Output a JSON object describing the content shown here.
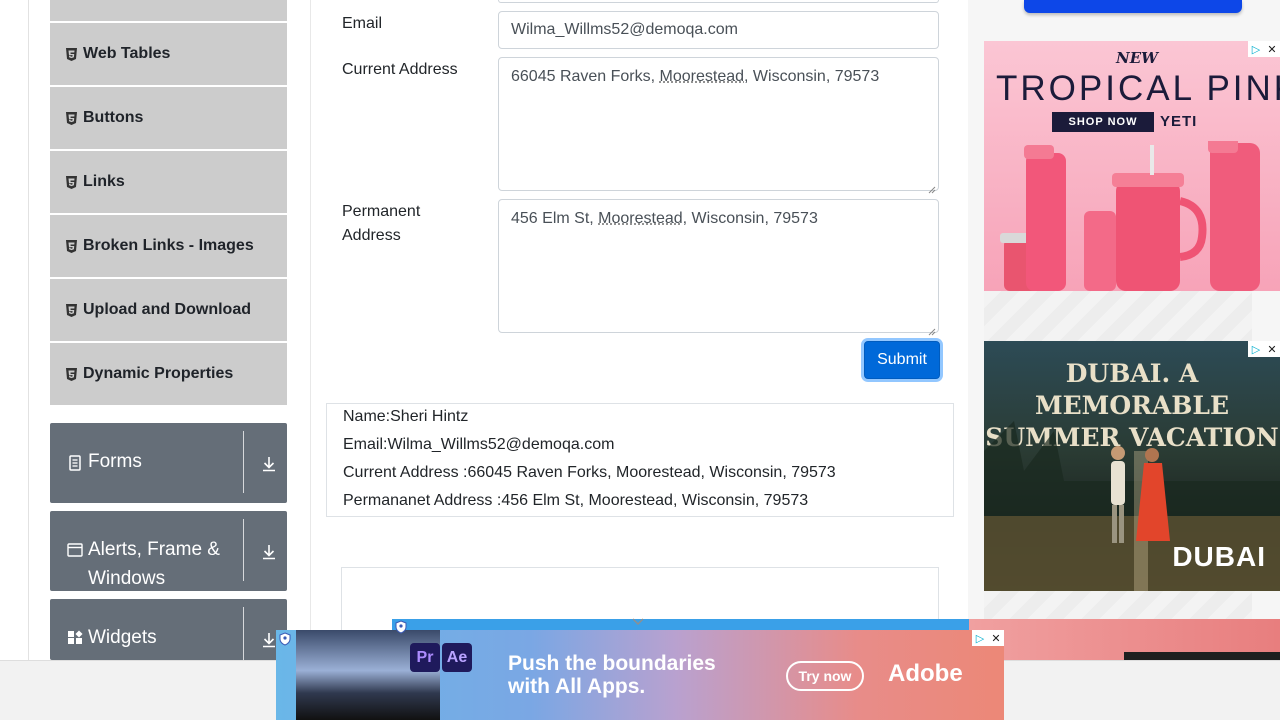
{
  "sidebar": {
    "elements_items": [
      {
        "label": "Web Tables"
      },
      {
        "label": "Buttons"
      },
      {
        "label": "Links"
      },
      {
        "label": "Broken Links - Images"
      },
      {
        "label": "Upload and Download"
      },
      {
        "label": "Dynamic Properties"
      }
    ],
    "groups": [
      {
        "label": "Forms"
      },
      {
        "label_line1": "Alerts, Frame &",
        "label_line2": "Windows"
      },
      {
        "label": "Widgets"
      }
    ]
  },
  "form": {
    "email": {
      "label": "Email",
      "value": "Wilma_Willms52@demoqa.com"
    },
    "current_address": {
      "label": "Current Address",
      "pre": "66045 Raven Forks, ",
      "underlined": "Moorestead",
      "post": ", Wisconsin, 79573"
    },
    "permanent_address": {
      "label_line1": "Permanent",
      "label_line2": "Address",
      "pre": "456 Elm St, ",
      "underlined": "Moorestead",
      "post": ", Wisconsin, 79573"
    },
    "submit_label": "Submit"
  },
  "output": {
    "name": "Name:Sheri Hintz",
    "email": "Email:Wilma_Willms52@demoqa.com",
    "current_address": "Current Address :66045 Raven Forks, Moorestead, Wisconsin, 79573",
    "permanent_address": "Permananet Address :456 Elm St, Moorestead, Wisconsin, 79573"
  },
  "ads": {
    "yeti": {
      "new": "NEW",
      "title": "TROPICAL PINK",
      "cta": "SHOP NOW",
      "brand": "YETI"
    },
    "dubai": {
      "title_line1": "DUBAI. A MEMORABLE",
      "title_line2": "SUMMER VACATION",
      "logo": "DUBAI"
    },
    "adobe": {
      "pr": "Pr",
      "ae": "Ae",
      "headline_line1": "Push the boundaries",
      "headline_line2": "with All Apps.",
      "cta": "Try now",
      "logo": "Adobe"
    },
    "adchoices_glyph": "▷",
    "close_glyph": "✕"
  },
  "colors": {
    "menu_bg": "#cccccc",
    "group_bg": "#656e78",
    "submit_bg": "#0069d9"
  }
}
